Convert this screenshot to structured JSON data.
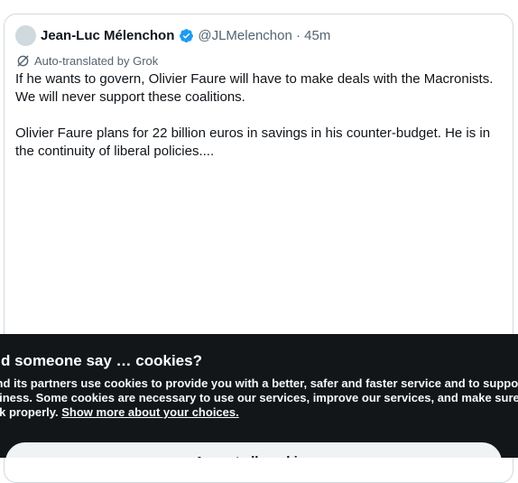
{
  "tweet": {
    "display_name": "Jean-Luc Mélenchon",
    "verified_icon": "verified-badge-icon",
    "handle_time": "@JLMelenchon · 45m",
    "translation_label": "Auto-translated by Grok",
    "paragraph_1": "If he wants to govern, Olivier Faure will have to make deals with the Macronists. We will never support these coalitions.",
    "paragraph_2": "Olivier Faure plans for 22 billion euros in savings in his counter-budget. He is in the continuity of liberal policies...."
  },
  "cookie_banner": {
    "title": "Did someone say … cookies?",
    "body": "X and its partners use cookies to provide you with a better, safer and faster service and to support our business. Some cookies are necessary to use our services, improve our services, and make sure they work properly.",
    "link_text": "Show more about your choices.",
    "accept_label": "Accept all cookies"
  },
  "colors": {
    "accent": "#1d9bf0",
    "banner_bg": "#121619",
    "text_secondary": "#536471"
  }
}
